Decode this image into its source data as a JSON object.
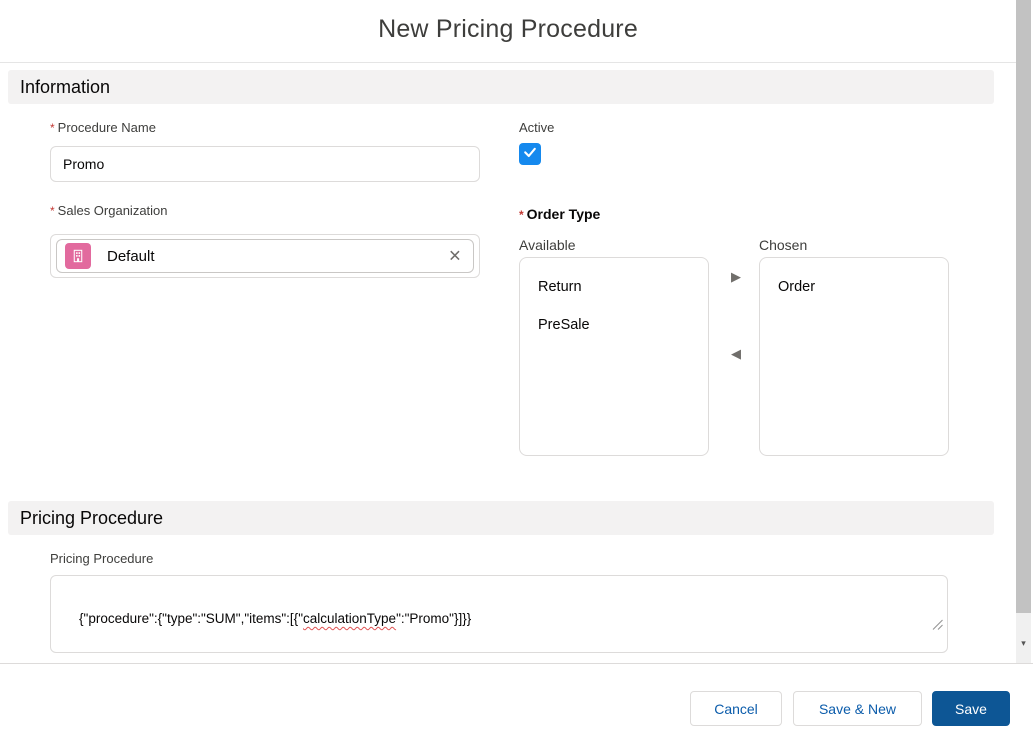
{
  "modal": {
    "title": "New Pricing Procedure",
    "sections": {
      "information": "Information",
      "pricing": "Pricing Procedure"
    }
  },
  "fields": {
    "procedure_name": {
      "label": "Procedure Name",
      "required_marker": "*",
      "value": "Promo"
    },
    "active": {
      "label": "Active",
      "checked": true
    },
    "sales_organization": {
      "label": "Sales Organization",
      "required_marker": "*",
      "selected_value": "Default"
    },
    "order_type": {
      "label": "Order Type",
      "required_marker": "*",
      "available_label": "Available",
      "chosen_label": "Chosen",
      "available_options": [
        "Return",
        "PreSale"
      ],
      "chosen_options": [
        "Order"
      ]
    },
    "pricing_procedure": {
      "label": "Pricing Procedure",
      "value_prefix": "{\"procedure\":{\"type\":\"SUM\",\"items\":[{\"",
      "value_misspelled_word": "calculationType",
      "value_suffix": "\":\"Promo\"}]}}"
    }
  },
  "footer": {
    "cancel_label": "Cancel",
    "save_new_label": "Save & New",
    "save_label": "Save"
  },
  "icons": {
    "move_right": "▶",
    "move_left": "◀",
    "clear": "×",
    "scroll_down": "▾"
  },
  "colors": {
    "accent_blue": "#0b5cab",
    "save_bg": "#0d5695",
    "checkbox_blue": "#1589ee",
    "icon_pink": "#e26a9e",
    "required_red": "#c23934"
  }
}
